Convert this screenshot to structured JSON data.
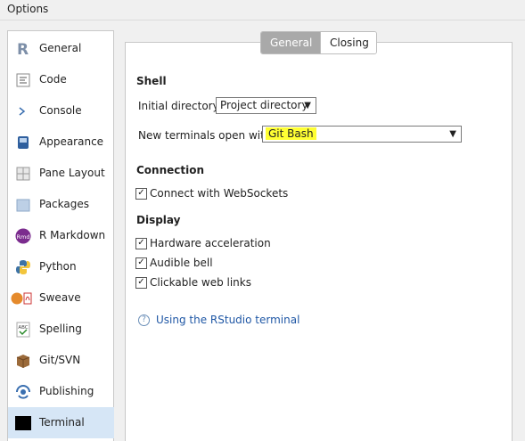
{
  "window": {
    "title": "Options"
  },
  "sidebar": {
    "items": [
      {
        "label": "General",
        "icon": "r-logo-icon"
      },
      {
        "label": "Code",
        "icon": "code-icon"
      },
      {
        "label": "Console",
        "icon": "console-icon"
      },
      {
        "label": "Appearance",
        "icon": "appearance-icon"
      },
      {
        "label": "Pane Layout",
        "icon": "pane-layout-icon"
      },
      {
        "label": "Packages",
        "icon": "packages-icon"
      },
      {
        "label": "R Markdown",
        "icon": "rmarkdown-icon"
      },
      {
        "label": "Python",
        "icon": "python-icon"
      },
      {
        "label": "Sweave",
        "icon": "sweave-icon"
      },
      {
        "label": "Spelling",
        "icon": "spelling-icon"
      },
      {
        "label": "Git/SVN",
        "icon": "git-svn-icon"
      },
      {
        "label": "Publishing",
        "icon": "publishing-icon"
      },
      {
        "label": "Terminal",
        "icon": "terminal-icon"
      }
    ],
    "selected": "Terminal"
  },
  "tabs": [
    {
      "label": "General",
      "active": true
    },
    {
      "label": "Closing",
      "active": false
    }
  ],
  "shell": {
    "heading": "Shell",
    "initial_directory_label": "Initial directory:",
    "initial_directory_value": "Project directory",
    "new_terminals_label": "New terminals open with:",
    "new_terminals_value": "Git Bash"
  },
  "connection": {
    "heading": "Connection",
    "websockets_label": "Connect with WebSockets",
    "websockets_checked": true
  },
  "display": {
    "heading": "Display",
    "hardware_label": "Hardware acceleration",
    "hardware_checked": true,
    "bell_label": "Audible bell",
    "bell_checked": true,
    "links_label": "Clickable web links",
    "links_checked": true
  },
  "help": {
    "link_text": "Using the RStudio terminal"
  },
  "colors": {
    "selected_bg": "#d6e6f6",
    "highlight": "#ffff33",
    "link": "#1f57a5"
  }
}
